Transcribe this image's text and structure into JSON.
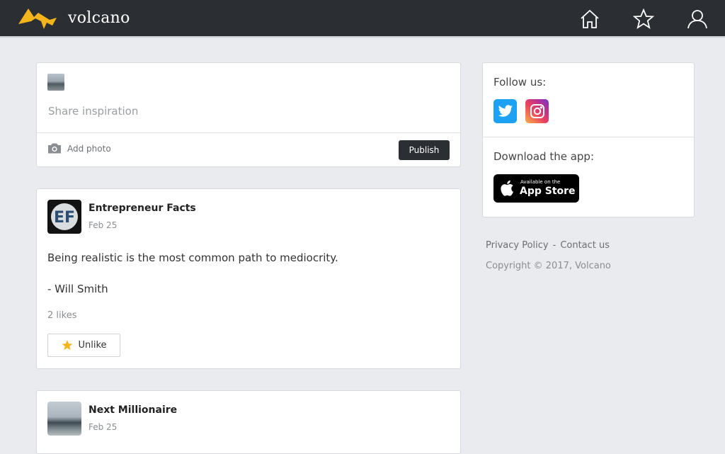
{
  "header": {
    "brand": "volcano",
    "nav_icons": [
      "home-icon",
      "star-icon",
      "user-icon"
    ]
  },
  "composer": {
    "placeholder": "Share inspiration",
    "add_photo": "Add photo",
    "publish": "Publish"
  },
  "posts": [
    {
      "author": "Entrepreneur Facts",
      "avatar_text": "EF",
      "date": "Feb 25",
      "body_line1": "Being realistic is the most common path to mediocrity.",
      "body_line2": "- Will Smith",
      "likes": "2 likes",
      "like_button": "Unlike"
    },
    {
      "author": "Next Millionaire",
      "date": "Feb 25"
    }
  ],
  "sidebar": {
    "follow_label": "Follow us:",
    "social": [
      "twitter-icon",
      "instagram-icon"
    ],
    "download_label": "Download the app:",
    "appstore_small": "Available on the",
    "appstore_big": "App Store"
  },
  "footer": {
    "privacy": "Privacy Policy",
    "separator": "-",
    "contact": "Contact us",
    "copyright": "Copyright © 2017, Volcano"
  },
  "colors": {
    "topbar": "#2b2e33",
    "background": "#e9ebee",
    "brand_logo": "#f3b51b",
    "star": "#f3b51b"
  }
}
